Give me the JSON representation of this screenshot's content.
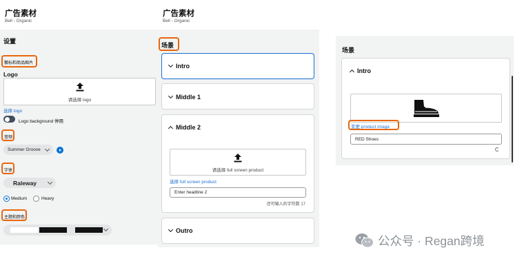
{
  "left": {
    "title": "广告素材",
    "subtitle": "Bell - Organic",
    "settings": "设置",
    "logo_section_label": "徽标和商品图片",
    "logo_heading": "Logo",
    "upload_logo_text": "请选择 logo",
    "choose_logo_link": "选择 logo",
    "logo_toggle_label": "Logo background 停用",
    "music_label": "音频",
    "music_value": "Summer Groove",
    "font_label": "字体",
    "font_value": "Raleway",
    "weight_medium": "Medium",
    "weight_heavy": "Heavy",
    "theme_label": "主题和颜色"
  },
  "middle": {
    "title": "广告素材",
    "subtitle": "Bell - Organic",
    "scenes_label": "场景",
    "scenes": [
      "Intro",
      "Middle 1",
      "Middle 2",
      "Outro"
    ],
    "upload_product_text": "请选择 full screen product",
    "choose_product_link": "选择 full screen product",
    "headline_value": "Enter headline 2",
    "char_count": "还可输入的字符数 17"
  },
  "right": {
    "scenes_label": "场景",
    "scene_title": "Intro",
    "change_product_link": "变更 product image",
    "product_name_value": "RED Shoes",
    "product_icon": "sneaker-icon"
  },
  "watermark": {
    "text": "公众号 · Regan跨境",
    "icon": "wechat-icon"
  },
  "colors": {
    "highlight": "#e8660c",
    "link": "#1a6fd1",
    "focus": "#0972d3"
  }
}
